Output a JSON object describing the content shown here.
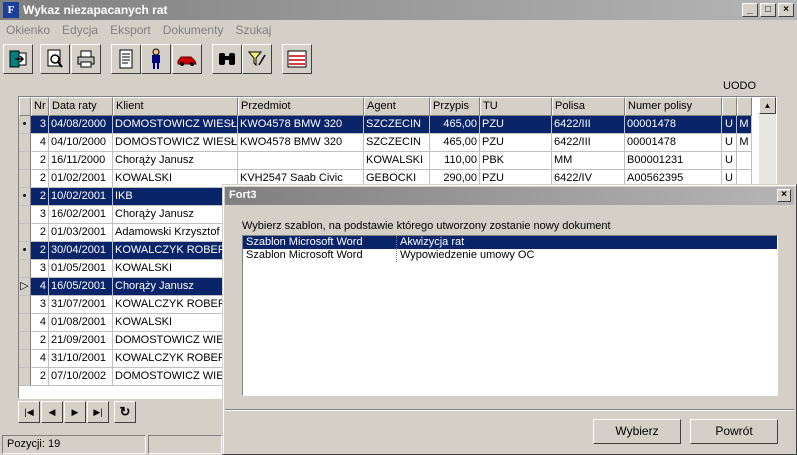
{
  "window": {
    "title": "Wykaz niezapacanych rat",
    "app_icon": "F",
    "min": "_",
    "max": "□",
    "close": "×"
  },
  "menu": [
    "Okienko",
    "Edycja",
    "Eksport",
    "Dokumenty",
    "Szukaj"
  ],
  "toolbar": {
    "buttons": [
      "exit-icon",
      "preview-icon",
      "print-icon",
      "document-icon",
      "person-icon",
      "car-icon",
      "binoculars-icon",
      "filter-icon",
      "list-icon"
    ]
  },
  "uodo_label": "UODO",
  "grid": {
    "columns": [
      "",
      "Nr",
      "Data raty",
      "Klient",
      "Przedmiot",
      "Agent",
      "Przypis",
      "TU",
      "Polisa",
      "Numer polisy",
      "",
      ""
    ],
    "rows": [
      {
        "ind": "•",
        "nr": "3",
        "date": "04/08/2000",
        "client": "DOMOSTOWICZ WIESŁ",
        "item": "KWO4578 BMW 320",
        "agent": "SZCZECIN",
        "amount": "465,00",
        "tu": "PZU",
        "polisa": "6422/III",
        "numer": "00001478",
        "u": "U",
        "m": "M",
        "sel": true
      },
      {
        "ind": "",
        "nr": "4",
        "date": "04/10/2000",
        "client": "DOMOSTOWICZ WIESŁ",
        "item": "KWO4578 BMW 320",
        "agent": "SZCZECIN",
        "amount": "465,00",
        "tu": "PZU",
        "polisa": "6422/III",
        "numer": "00001478",
        "u": "U",
        "m": "M",
        "sel": false
      },
      {
        "ind": "",
        "nr": "2",
        "date": "16/11/2000",
        "client": "Chorąży Janusz",
        "item": "",
        "agent": "KOWALSKI",
        "amount": "110,00",
        "tu": "PBK",
        "polisa": "MM",
        "numer": "B00001231",
        "u": "U",
        "m": "",
        "sel": false
      },
      {
        "ind": "",
        "nr": "2",
        "date": "01/02/2001",
        "client": "KOWALSKI",
        "item": "KVH2547 Saab Civic",
        "agent": "GEBOCKI",
        "amount": "290,00",
        "tu": "PZU",
        "polisa": "6422/IV",
        "numer": "A00562395",
        "u": "U",
        "m": "",
        "sel": false
      },
      {
        "ind": "•",
        "nr": "2",
        "date": "10/02/2001",
        "client": "IKB",
        "item": "",
        "agent": "",
        "amount": "",
        "tu": "",
        "polisa": "",
        "numer": "",
        "u": "",
        "m": "",
        "sel": true
      },
      {
        "ind": "",
        "nr": "3",
        "date": "16/02/2001",
        "client": "Chorąży Janusz",
        "item": "",
        "agent": "",
        "amount": "",
        "tu": "",
        "polisa": "",
        "numer": "",
        "u": "",
        "m": "",
        "sel": false
      },
      {
        "ind": "",
        "nr": "2",
        "date": "01/03/2001",
        "client": "Adamowski Krzysztof",
        "item": "",
        "agent": "",
        "amount": "",
        "tu": "",
        "polisa": "",
        "numer": "",
        "u": "",
        "m": "",
        "sel": false
      },
      {
        "ind": "•",
        "nr": "2",
        "date": "30/04/2001",
        "client": "KOWALCZYK ROBERT",
        "item": "",
        "agent": "",
        "amount": "",
        "tu": "",
        "polisa": "",
        "numer": "",
        "u": "",
        "m": "",
        "sel": true
      },
      {
        "ind": "",
        "nr": "3",
        "date": "01/05/2001",
        "client": "KOWALSKI",
        "item": "",
        "agent": "",
        "amount": "",
        "tu": "",
        "polisa": "",
        "numer": "",
        "u": "",
        "m": "",
        "sel": false
      },
      {
        "ind": "▷",
        "nr": "4",
        "date": "16/05/2001",
        "client": "Chorąży Janusz",
        "item": "",
        "agent": "",
        "amount": "",
        "tu": "",
        "polisa": "",
        "numer": "",
        "u": "",
        "m": "",
        "sel": true
      },
      {
        "ind": "",
        "nr": "3",
        "date": "31/07/2001",
        "client": "KOWALCZYK ROBERT",
        "item": "",
        "agent": "",
        "amount": "",
        "tu": "",
        "polisa": "",
        "numer": "",
        "u": "",
        "m": "",
        "sel": false
      },
      {
        "ind": "",
        "nr": "4",
        "date": "01/08/2001",
        "client": "KOWALSKI",
        "item": "",
        "agent": "",
        "amount": "",
        "tu": "",
        "polisa": "",
        "numer": "",
        "u": "",
        "m": "",
        "sel": false
      },
      {
        "ind": "",
        "nr": "2",
        "date": "21/09/2001",
        "client": "DOMOSTOWICZ WIESŁ",
        "item": "",
        "agent": "",
        "amount": "",
        "tu": "",
        "polisa": "",
        "numer": "",
        "u": "",
        "m": "",
        "sel": false
      },
      {
        "ind": "",
        "nr": "4",
        "date": "31/10/2001",
        "client": "KOWALCZYK ROBERT",
        "item": "",
        "agent": "",
        "amount": "",
        "tu": "",
        "polisa": "",
        "numer": "",
        "u": "",
        "m": "",
        "sel": false
      },
      {
        "ind": "",
        "nr": "2",
        "date": "07/10/2002",
        "client": "DOMOSTOWICZ WIESŁ",
        "item": "",
        "agent": "",
        "amount": "",
        "tu": "",
        "polisa": "",
        "numer": "",
        "u": "",
        "m": "",
        "sel": false
      }
    ]
  },
  "nav": {
    "first": "|◀",
    "prev": "◀",
    "next": "▶",
    "last": "▶|",
    "refresh": "↻"
  },
  "status": {
    "count": "Pozycji: 19"
  },
  "dialog": {
    "title": "Fort3",
    "close": "×",
    "prompt": "Wybierz szablon, na podstawie którego utworzony zostanie nowy dokument",
    "items": [
      {
        "type": "Szablon Microsoft Word",
        "name": "Akwizycja rat",
        "sel": true
      },
      {
        "type": "Szablon Microsoft Word",
        "name": "Wypowiedzenie umowy OC",
        "sel": false
      }
    ],
    "ok_label": "Wybierz",
    "cancel_label": "Powrót"
  }
}
